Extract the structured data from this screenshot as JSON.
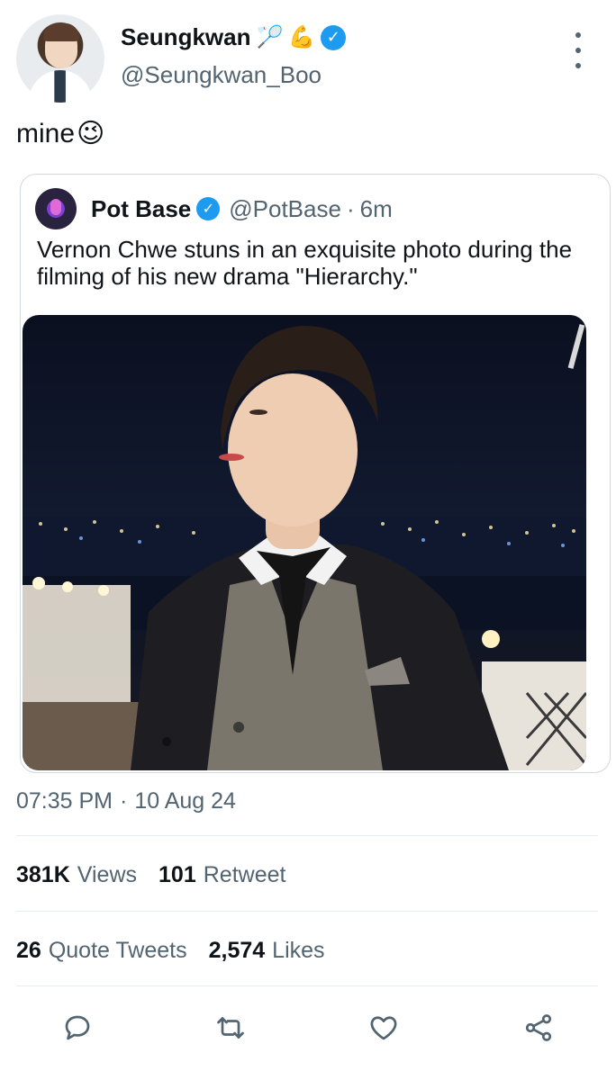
{
  "author": {
    "display_name": "Seungkwan",
    "name_emojis": [
      "🏸",
      "💪"
    ],
    "handle": "@Seungkwan_Boo",
    "verified": true
  },
  "tweet": {
    "text": "mine",
    "emoji": "😉"
  },
  "quote": {
    "display_name": "Pot Base",
    "handle": "@PotBase",
    "separator": "·",
    "time": "6m",
    "text": "Vernon Chwe stuns in an exquisite photo during the filming of his new drama \"Hierarchy.\""
  },
  "meta": {
    "time": "07:35 PM",
    "separator": "·",
    "date": "10 Aug 24"
  },
  "stats": {
    "views_count": "381K",
    "views_label": "Views",
    "retweets_count": "101",
    "retweets_label": "Retweet",
    "quotes_count": "26",
    "quotes_label": "Quote Tweets",
    "likes_count": "2,574",
    "likes_label": "Likes"
  },
  "actions": [
    "reply-icon",
    "retweet-icon",
    "like-icon",
    "share-icon"
  ],
  "colors": {
    "accent": "#1d9bf0",
    "secondary_text": "#536471",
    "primary_text": "#0f1419",
    "divider": "#e6ecf0"
  }
}
